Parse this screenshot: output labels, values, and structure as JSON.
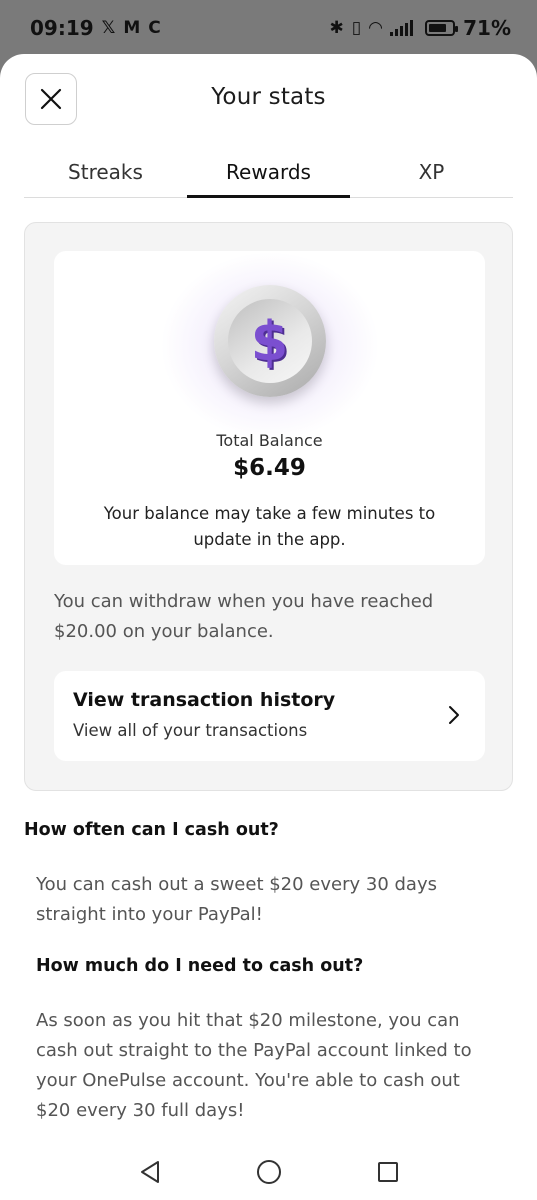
{
  "status_bar": {
    "time": "09:19",
    "notification_icons": [
      "x-logo-icon",
      "gmail-icon",
      "c-app-icon"
    ],
    "battery": "71%"
  },
  "header": {
    "title": "Your stats",
    "close_icon": "close-icon"
  },
  "tabs": [
    {
      "label": "Streaks",
      "active": false
    },
    {
      "label": "Rewards",
      "active": true
    },
    {
      "label": "XP",
      "active": false
    }
  ],
  "balance_card": {
    "icon": "dollar-coin-icon",
    "label": "Total Balance",
    "amount": "$6.49",
    "note": "Your balance may take a few minutes to update in the app."
  },
  "withdraw_note": "You can withdraw when you have reached $20.00 on your balance.",
  "transaction_card": {
    "title": "View transaction history",
    "subtitle": "View all of your transactions",
    "icon": "chevron-right-icon"
  },
  "faq": [
    {
      "question": "How often can I cash out?",
      "answer": "You can cash out a sweet $20 every 30 days straight into your PayPal!"
    },
    {
      "question": "How much do I need to cash out?",
      "answer": "As soon as you hit that $20 milestone, you can cash out straight to the PayPal account linked to your OnePulse account. You're able to cash out $20 every 30 full days!"
    }
  ],
  "colors": {
    "accent_purple": "#7b4fd0",
    "panel_bg": "#f4f4f4",
    "status_bar_bg": "#7a7a7a"
  }
}
